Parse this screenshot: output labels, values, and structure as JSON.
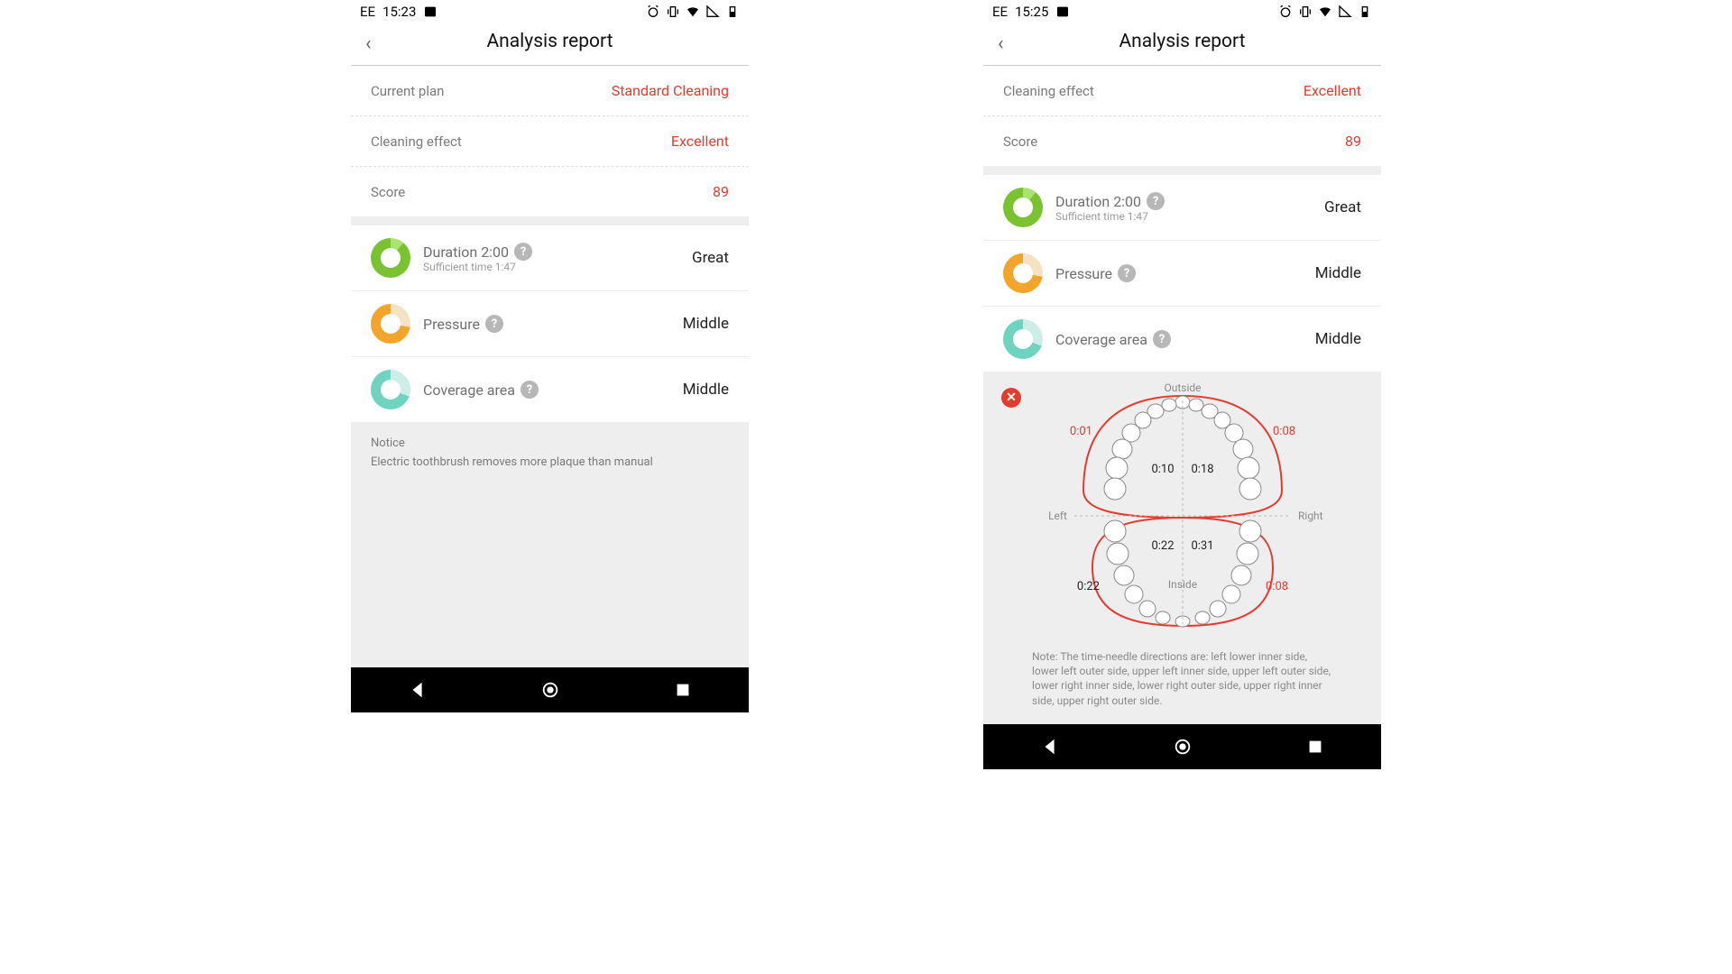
{
  "left": {
    "status": {
      "carrier": "EE",
      "time": "15:23"
    },
    "title": "Analysis report",
    "summary": {
      "plan_label": "Current plan",
      "plan_value": "Standard Cleaning",
      "effect_label": "Cleaning effect",
      "effect_value": "Excellent",
      "score_label": "Score",
      "score_value": "89"
    },
    "metrics": {
      "duration_title": "Duration 2:00",
      "duration_sub": "Sufficient time 1:47",
      "duration_value": "Great",
      "pressure_title": "Pressure",
      "pressure_value": "Middle",
      "coverage_title": "Coverage area",
      "coverage_value": "Middle"
    },
    "notice": {
      "title": "Notice",
      "body": "Electric toothbrush removes more plaque than manual"
    }
  },
  "right": {
    "status": {
      "carrier": "EE",
      "time": "15:25"
    },
    "title": "Analysis report",
    "summary": {
      "effect_label": "Cleaning effect",
      "effect_value": "Excellent",
      "score_label": "Score",
      "score_value": "89"
    },
    "metrics": {
      "duration_title": "Duration 2:00",
      "duration_sub": "Sufficient time 1:47",
      "duration_value": "Great",
      "pressure_title": "Pressure",
      "pressure_value": "Middle",
      "coverage_title": "Coverage area",
      "coverage_value": "Middle"
    },
    "diagram": {
      "outside": "Outside",
      "inside": "Inside",
      "left": "Left",
      "right": "Right",
      "t_upper_left_outer": "0:01",
      "t_upper_right_outer": "0:08",
      "t_upper_left_inner": "0:10",
      "t_upper_right_inner": "0:18",
      "t_lower_left_inner": "0:22",
      "t_lower_right_inner": "0:31",
      "t_lower_left_outer": "0:22",
      "t_lower_right_outer": "0:08",
      "note": "Note: The time-needle directions are: left lower inner side, lower left outer side, upper left inner side, upper left outer side, lower right inner side, lower right outer side, upper right inner side, upper right outer side."
    }
  },
  "colors": {
    "accent": "#e23c2f",
    "green": "#7ac22f",
    "green_light": "#a9e470",
    "orange": "#f2a52a",
    "orange_light": "#f3e3c2",
    "teal": "#6fd4bf",
    "teal_light": "#cdeee6"
  }
}
